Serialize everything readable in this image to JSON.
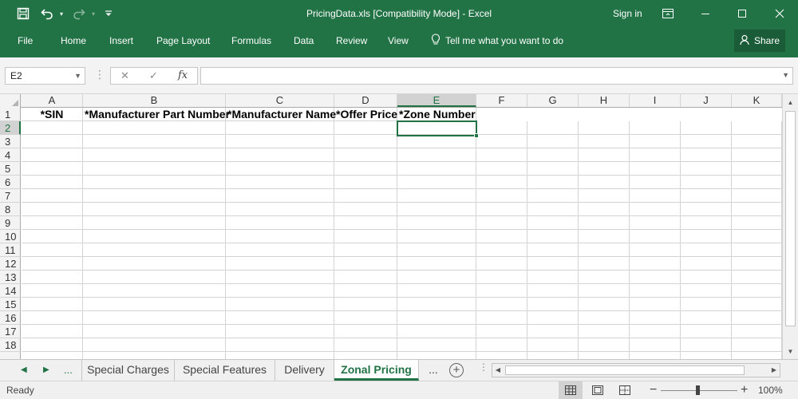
{
  "window": {
    "title": "PricingData.xls  [Compatibility Mode] - Excel",
    "sign_in": "Sign in"
  },
  "ribbon": {
    "tabs": [
      "File",
      "Home",
      "Insert",
      "Page Layout",
      "Formulas",
      "Data",
      "Review",
      "View"
    ],
    "tell_me": "Tell me what you want to do",
    "share": "Share"
  },
  "formula_bar": {
    "name_box": "E2",
    "fx_label": "fx",
    "formula": ""
  },
  "grid": {
    "columns": [
      "A",
      "B",
      "C",
      "D",
      "E",
      "F",
      "G",
      "H",
      "I",
      "J",
      "K"
    ],
    "selected_column": "E",
    "rows": [
      "1",
      "2",
      "3",
      "4",
      "5",
      "6",
      "7",
      "8",
      "9",
      "10",
      "11",
      "12",
      "13",
      "14",
      "15",
      "16",
      "17",
      "18"
    ],
    "selected_row": "2",
    "header_cells": {
      "A1": "*SIN",
      "B1": "*Manufacturer Part Number",
      "C1": "*Manufacturer Name",
      "D1": "*Offer Price",
      "E1": "*Zone Number"
    }
  },
  "sheets": {
    "leading_ellipsis": "...",
    "tabs": [
      "Special Charges",
      "Special Features",
      "Delivery",
      "Zonal Pricing"
    ],
    "active": "Zonal Pricing",
    "trailing_ellipsis": "...",
    "add_label": "+"
  },
  "status": {
    "ready": "Ready",
    "zoom": "100%"
  },
  "colors": {
    "accent": "#217346"
  }
}
